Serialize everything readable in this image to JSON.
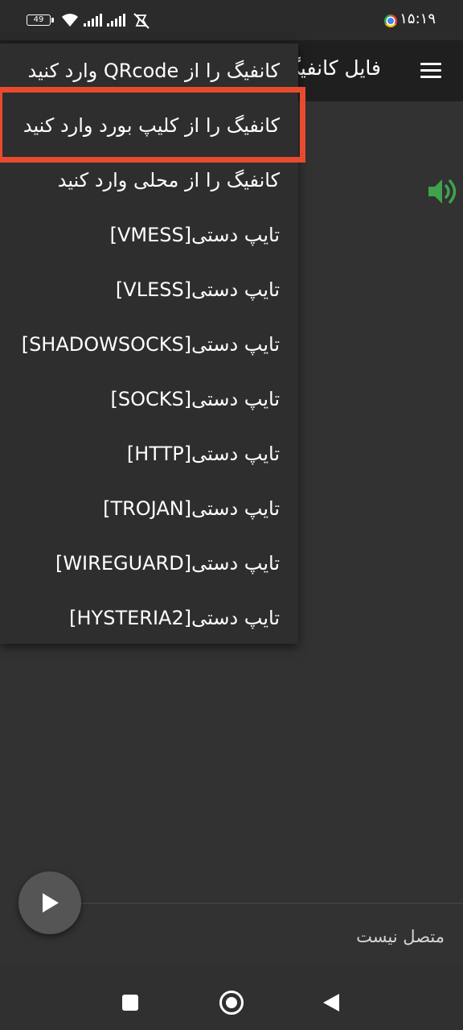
{
  "status_bar": {
    "time": "۱۵:۱۹",
    "battery_level": "49",
    "icons": [
      "chrome-icon",
      "mute-icon",
      "signal-icon",
      "signal-icon",
      "wifi-icon",
      "battery-icon"
    ]
  },
  "toolbar": {
    "title": "فایل کانفیگ",
    "menu_icon": "hamburger-menu-icon"
  },
  "popup_menu": {
    "items": [
      {
        "label": "کانفیگ را از QRcode وارد کنید"
      },
      {
        "label": "کانفیگ را از کلیپ بورد وارد کنید",
        "highlighted": true
      },
      {
        "label": "کانفیگ را از محلی وارد کنید"
      },
      {
        "label": "تایپ دستی[VMESS]"
      },
      {
        "label": "تایپ دستی[VLESS]"
      },
      {
        "label": "تایپ دستی[SHADOWSOCKS]"
      },
      {
        "label": "تایپ دستی[SOCKS]"
      },
      {
        "label": "تایپ دستی[HTTP]"
      },
      {
        "label": "تایپ دستی[TROJAN]"
      },
      {
        "label": "تایپ دستی[WIREGUARD]"
      },
      {
        "label": "تایپ دستی[HYSTERIA2]"
      }
    ],
    "highlight_color": "#e84a2f"
  },
  "speaker_icon_color": "#3fa34d",
  "fab": {
    "icon": "play-icon"
  },
  "connection_status": "متصل نیست",
  "nav_bar": {
    "icons": [
      "recents-square-icon",
      "home-circle-icon",
      "back-triangle-icon"
    ]
  },
  "colors": {
    "background": "#323232",
    "toolbar": "#1f1f1f",
    "popup": "#2e2e2e"
  }
}
